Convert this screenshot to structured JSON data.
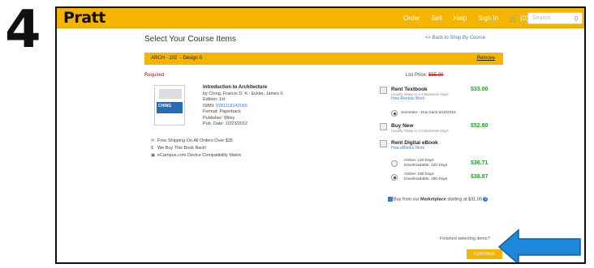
{
  "step_number": "4",
  "header": {
    "logo": "Pratt",
    "nav": [
      "Order",
      "Sell",
      "Help",
      "Sign In"
    ],
    "cart_label": "(0)",
    "search_placeholder": "Search"
  },
  "page": {
    "title": "Select Your Course Items",
    "back_link": "<< Back to Shop By Course"
  },
  "course": {
    "code": "ARCH - 102",
    "name": "- Design II",
    "remove_label": "Remove"
  },
  "required_label": "Required",
  "list_price": {
    "label": "List Price:",
    "value": "$55.00"
  },
  "book": {
    "cover_text": "CHING",
    "title": "Introduction to Architecture",
    "authors": "by Ching, Francis D. K.; Eckler, James F.",
    "edition": "Edition: 1st",
    "isbn_label": "ISBN:",
    "isbn": "9781118142066",
    "format": "Format: Paperback",
    "publisher": "Publisher: Wiley",
    "pub_date": "Pub. Date: 10/23/2012"
  },
  "perks": [
    "Free Shipping On All Orders Over $35",
    "We Buy This Book Back!",
    "eCampus.com Device Compatibility Matrix"
  ],
  "options": {
    "rent_textbook": {
      "name": "Rent Textbook",
      "sub": "Usually Ships in 3-4 Business Days",
      "link": "How Rentals Work",
      "price": "$33.00",
      "radio_label": "Semester - Due back 5/18/2018"
    },
    "buy_new": {
      "name": "Buy New",
      "sub": "Usually Ships in 3-4 Business Days",
      "price": "$52.80"
    },
    "rent_ebook": {
      "name": "Rent Digital eBook",
      "link": "How eBooks Work",
      "choices": [
        {
          "line1": "Online: 120 Days",
          "line2": "Downloadable: 120 Days",
          "price": "$36.71"
        },
        {
          "line1": "Online: 180 Days",
          "line2": "Downloadable: 180 Days",
          "price": "$38.87"
        }
      ]
    }
  },
  "marketplace": {
    "prefix": "Buy from our",
    "name": "Marketplace",
    "suffix": "starting at $31.00"
  },
  "footer": {
    "finished": "Finished selecting items?",
    "continue": "CONTINUE"
  },
  "colors": {
    "accent": "#f4b400",
    "arrow": "#1e88d8",
    "price": "#2a9d2a",
    "link": "#3a7bd5"
  }
}
